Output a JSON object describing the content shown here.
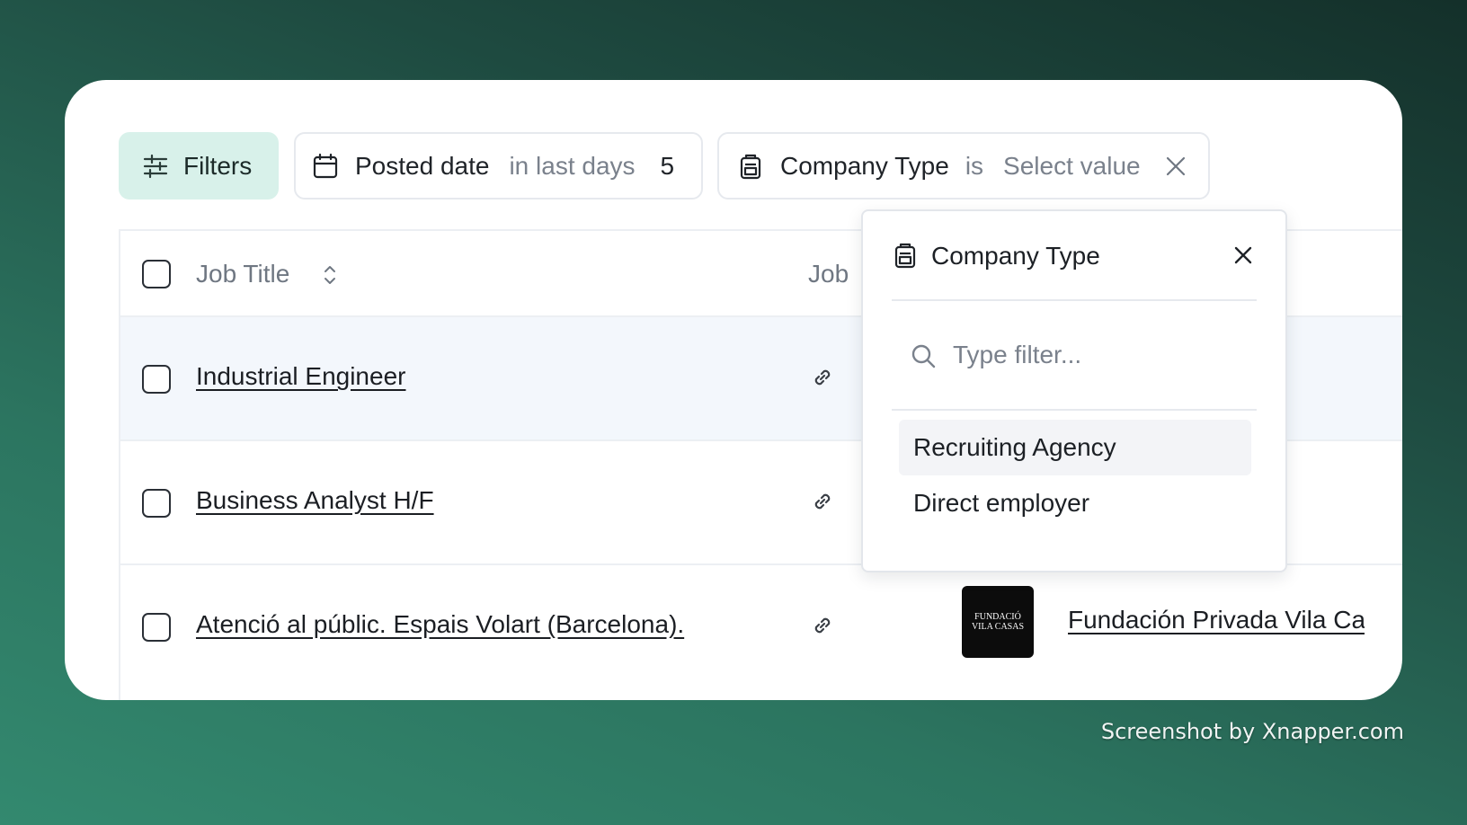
{
  "toolbar": {
    "filters_label": "Filters",
    "posted_date": {
      "field": "Posted date",
      "operator": "in last days",
      "value": "5"
    },
    "company_type": {
      "field": "Company Type",
      "operator": "is",
      "value": "Select value"
    }
  },
  "table": {
    "columns": [
      "Job Title",
      "Job"
    ],
    "rows": [
      {
        "job_title": "Industrial Engineer"
      },
      {
        "job_title": "Business Analyst H/F"
      },
      {
        "job_title": "Atenció al públic. Espais Volart (Barcelona).",
        "company_logo_text": "FUNDACIÓ VILA CASAS",
        "company": "Fundación Privada Vila Casas"
      }
    ]
  },
  "dropdown": {
    "title": "Company Type",
    "search_placeholder": "Type filter...",
    "options": [
      "Recruiting Agency",
      "Direct employer"
    ]
  },
  "watermark": "Screenshot by Xnapper.com",
  "colors": {
    "accent": "#d8f1ea",
    "row_highlight": "#f3f7fc",
    "text": "#1b1e23",
    "muted": "#7a818c"
  }
}
